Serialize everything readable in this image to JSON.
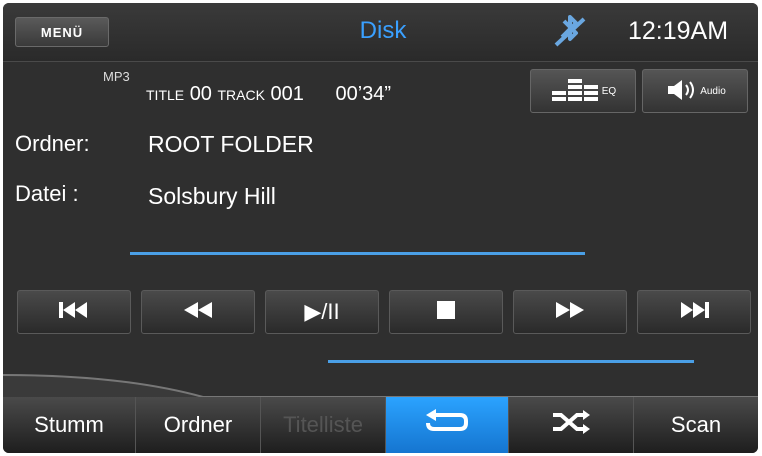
{
  "header": {
    "menu_label": "MENÜ",
    "source": "Disk",
    "clock": "12:19AM",
    "icons": [
      "bluetooth-off-icon"
    ]
  },
  "track": {
    "format": "MP3",
    "title_label": "TITLE",
    "title_num": "00",
    "track_label": "TRACK",
    "track_num": "001",
    "elapsed": "00’34”"
  },
  "buttons": {
    "eq_label": "EQ",
    "audio_label": "Audio"
  },
  "info": {
    "folder_label": "Ordner:",
    "folder_value": "ROOT FOLDER",
    "file_label": "Datei  :",
    "file_value": "Solsbury Hill"
  },
  "transport": [
    {
      "name": "previous-track",
      "icon": "skip-previous-icon"
    },
    {
      "name": "rewind",
      "icon": "rewind-icon"
    },
    {
      "name": "play-pause",
      "icon": "play-pause-icon",
      "label": "▶/II"
    },
    {
      "name": "stop",
      "icon": "stop-icon"
    },
    {
      "name": "fast-forward",
      "icon": "fast-forward-icon"
    },
    {
      "name": "next-track",
      "icon": "skip-next-icon"
    }
  ],
  "tabs": {
    "mute": "Stumm",
    "folder": "Ordner",
    "title_list": "Titelliste",
    "repeat_icon": "repeat-icon",
    "shuffle_icon": "shuffle-icon",
    "scan": "Scan"
  },
  "colors": {
    "accent": "#3aa0ff",
    "active_tab": "#1e8cee",
    "background": "#2f2f2f"
  }
}
